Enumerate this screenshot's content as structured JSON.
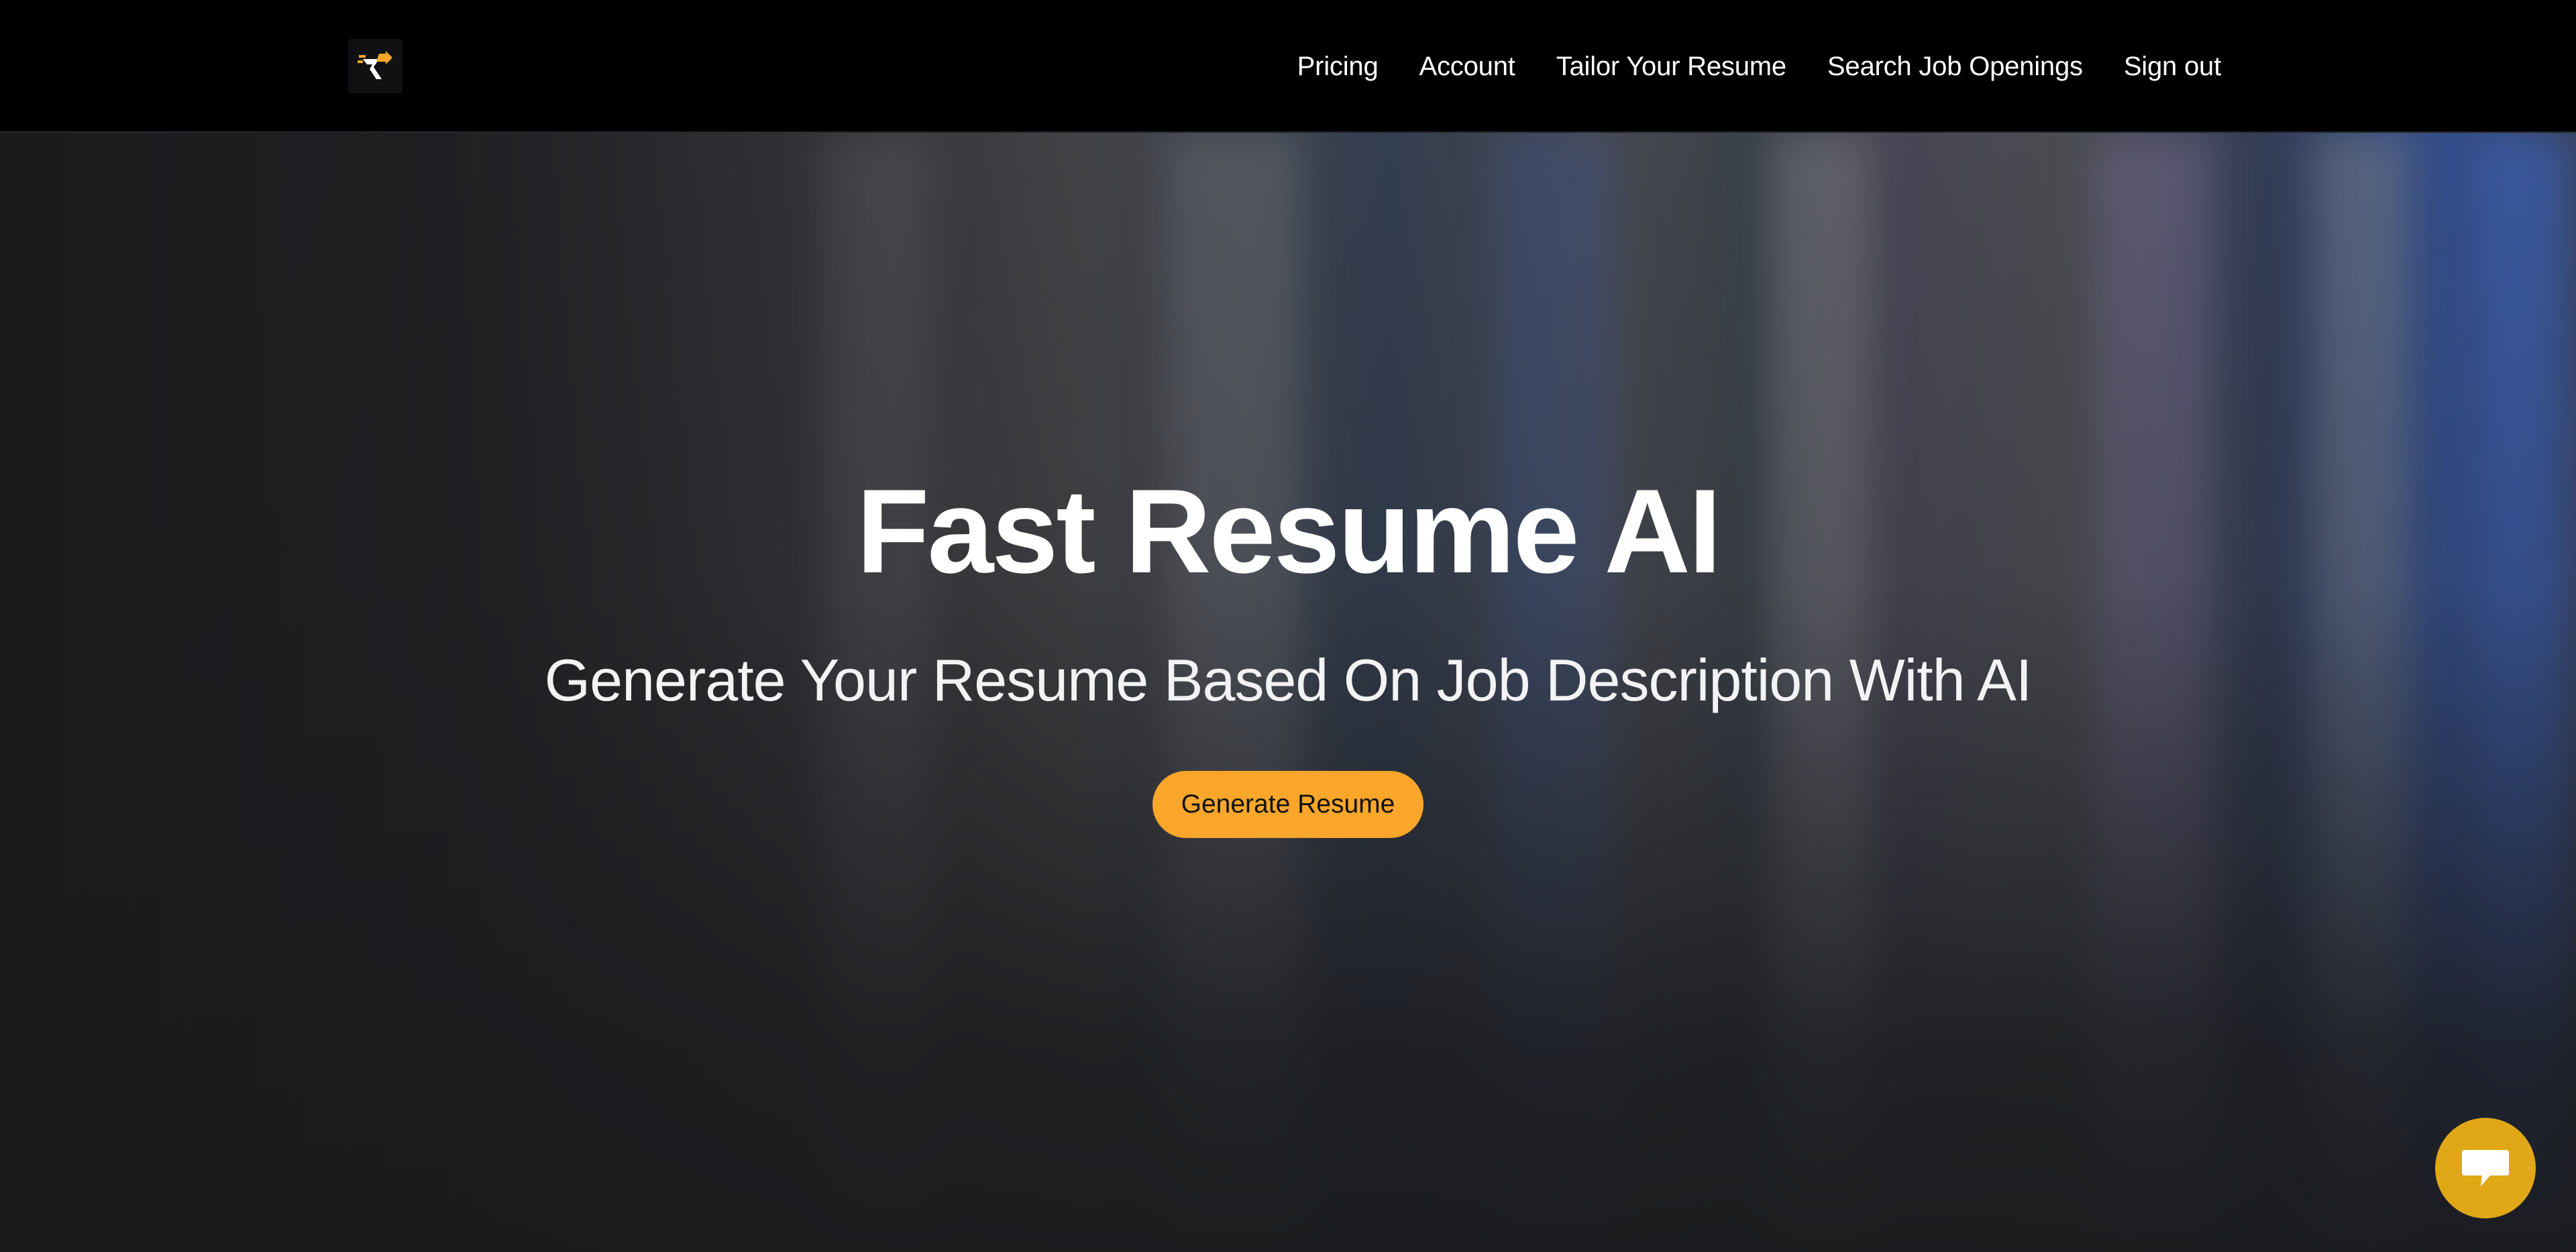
{
  "header": {
    "logo_icon": "fast-resume-logo",
    "nav": [
      {
        "label": "Pricing"
      },
      {
        "label": "Account"
      },
      {
        "label": "Tailor Your Resume"
      },
      {
        "label": "Search Job Openings"
      },
      {
        "label": "Sign out"
      }
    ]
  },
  "hero": {
    "title": "Fast Resume AI",
    "subtitle": "Generate Your Resume Based On Job Description With AI",
    "cta_label": "Generate Resume"
  },
  "chat_widget": {
    "icon": "chat-bubble-icon"
  },
  "colors": {
    "header_bg": "#000000",
    "accent": "#f9a62b",
    "chat_button": "#e0a817",
    "hero_bg": "#1b1b1e"
  }
}
